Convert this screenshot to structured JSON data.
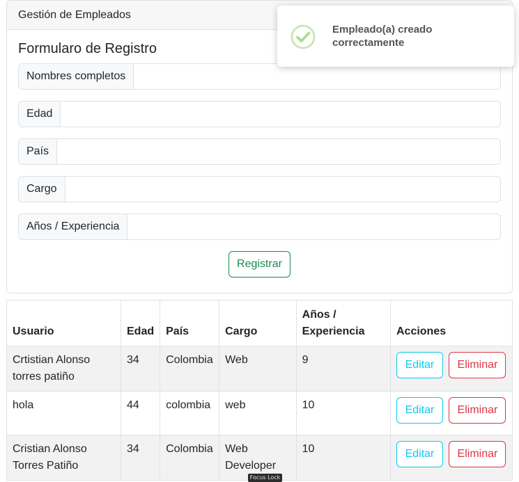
{
  "card": {
    "header": "Gestión de Empleados",
    "form_title": "Formularo de Registro"
  },
  "form": {
    "fields": [
      {
        "label": "Nombres completos",
        "value": ""
      },
      {
        "label": "Edad",
        "value": ""
      },
      {
        "label": "País",
        "value": ""
      },
      {
        "label": "Cargo",
        "value": ""
      },
      {
        "label": "Años / Experiencia",
        "value": ""
      }
    ],
    "submit_label": "Registrar"
  },
  "toast": {
    "message": "Empleado(a) creado correctamente",
    "icon": "success-check-icon"
  },
  "table": {
    "headers": [
      "Usuario",
      "Edad",
      "País",
      "Cargo",
      "Años / Experiencia",
      "Acciones"
    ],
    "rows": [
      {
        "usuario": "Crtistian Alonso torres patiño",
        "edad": "34",
        "pais": "Colombia",
        "cargo": "Web",
        "experiencia": "9"
      },
      {
        "usuario": "hola",
        "edad": "44",
        "pais": "colombia",
        "cargo": "web",
        "experiencia": "10"
      },
      {
        "usuario": "Cristian Alonso Torres Patiño",
        "edad": "34",
        "pais": "Colombia",
        "cargo": "Web Developer",
        "experiencia": "10"
      }
    ],
    "edit_label": "Editar",
    "delete_label": "Eliminar"
  },
  "overlay": {
    "focus_lock_label": "Focus Lock"
  },
  "colors": {
    "success": "#198754",
    "info": "#0dcaf0",
    "danger": "#dc3545",
    "toast_check": "#a5dc86"
  }
}
